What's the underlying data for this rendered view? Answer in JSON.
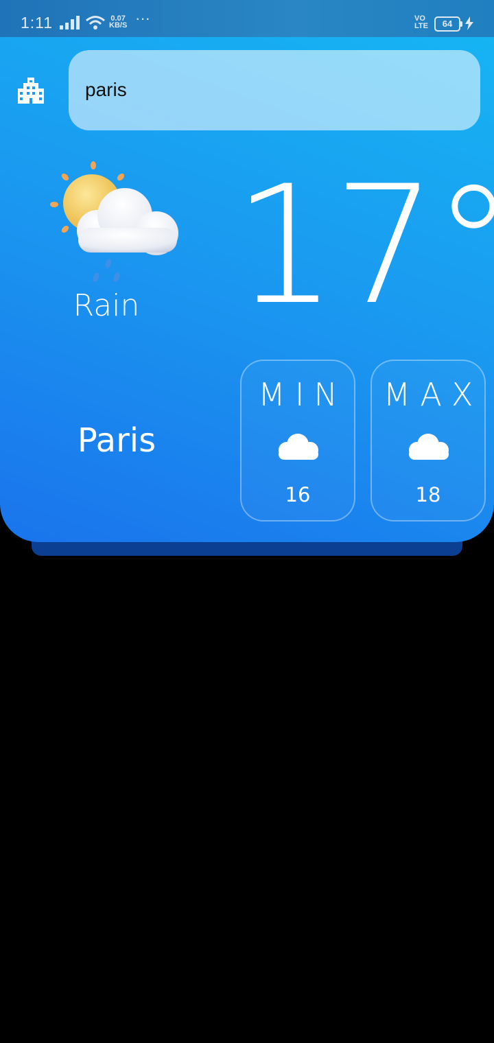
{
  "status_bar": {
    "time": "1:11",
    "net_speed_value": "0.07",
    "net_speed_unit": "KB/S",
    "more": "···",
    "volte_top": "VO",
    "volte_bottom": "LTE",
    "battery": "64"
  },
  "search": {
    "value": "paris"
  },
  "weather": {
    "condition": "Rain",
    "temperature": "17°",
    "city": "Paris",
    "min_label": "MIN",
    "min_value": "16",
    "max_label": "MAX",
    "max_value": "18"
  },
  "icons": {
    "left_of_search": "city-buildings-icon",
    "condition": "sun-cloud-rain-icon",
    "min": "cloud-icon",
    "max": "cloud-icon"
  },
  "colors": {
    "card_top": "#16b4f3",
    "card_bottom": "#1a74ec",
    "card_shadow": "#0b3f91"
  }
}
